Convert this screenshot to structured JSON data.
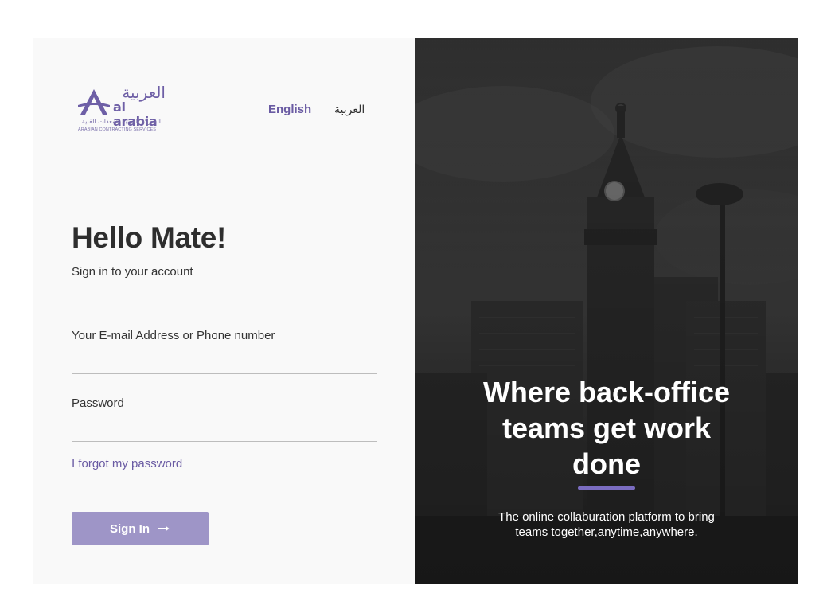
{
  "logo": {
    "arabic_name": "العربية",
    "latin_name": "al arabia",
    "arabic_subtitle": "الشركة العربية للمعدات الفنية",
    "english_subtitle": "ARABIAN CONTRACTING SERVICES",
    "brand_color": "#6e5fa6"
  },
  "language": {
    "english_label": "English",
    "arabic_label": "العربية",
    "active": "English"
  },
  "login": {
    "title": "Hello Mate!",
    "subtitle": "Sign in to your account",
    "email_label": "Your E-mail Address or Phone number",
    "email_value": "",
    "password_label": "Password",
    "password_value": "",
    "forgot_label": "I forgot my password",
    "signin_label": "Sign In",
    "signin_icon": "arrow-right-icon",
    "button_color": "#9e95c7",
    "accent_color": "#6a5ba3"
  },
  "hero": {
    "title": "Where back-office teams get work done",
    "text": "The online collaburation platform to bring teams together,anytime,anywhere.",
    "rule_color": "#7a6cc0",
    "background": "dark photo of clock tower"
  }
}
